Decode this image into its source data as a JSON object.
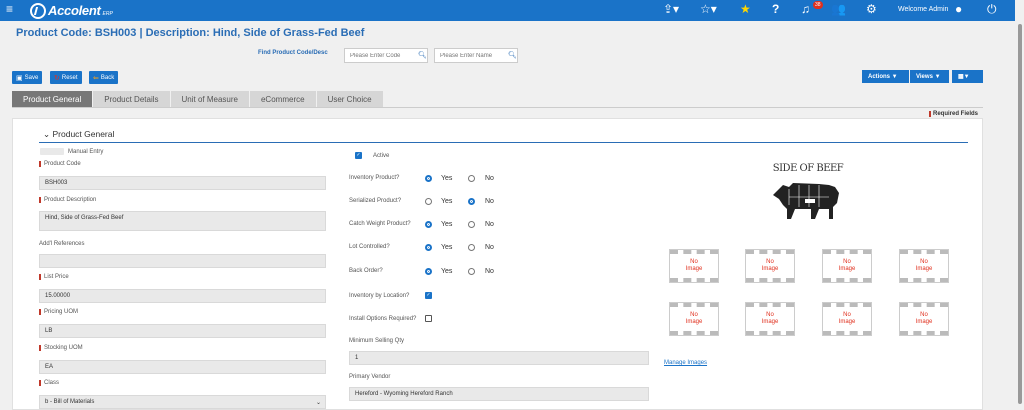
{
  "topbar": {
    "logo_text": "Accolent",
    "logo_suffix": "ERP",
    "notification_count": "38",
    "welcome": "Welcome Admin",
    "icons": [
      "menu-icon",
      "share-icon",
      "star-outline-icon",
      "star-icon",
      "help-icon",
      "bell-icon",
      "users-icon",
      "gear-icon",
      "user-icon",
      "power-icon"
    ]
  },
  "header": {
    "title": "Product Code:  BSH003 | Description: Hind, Side of Grass-Fed Beef",
    "find_label": "Find Product Code/Desc",
    "code_placeholder": "Please Enter Code",
    "name_placeholder": "Please Enter Name"
  },
  "toolbar": {
    "save": "Save",
    "reset": "Reset",
    "back": "Back",
    "actions": "Actions ▼",
    "views": "Views ▼",
    "grid": "▼"
  },
  "tabs": [
    {
      "label": "Product General",
      "active": true
    },
    {
      "label": "Product Details",
      "active": false
    },
    {
      "label": "Unit of Measure",
      "active": false
    },
    {
      "label": "eCommerce",
      "active": false
    },
    {
      "label": "User Choice",
      "active": false
    }
  ],
  "required_fields": "Required Fields",
  "section": {
    "title": "Product General"
  },
  "left": {
    "manual_entry": "Manual Entry",
    "product_code_label": "Product Code",
    "product_code": "BSH003",
    "product_desc_label": "Product Description",
    "product_desc": "Hind, Side of Grass-Fed Beef",
    "addl_ref_label": "Add'l References",
    "addl_ref": "",
    "list_price_label": "List Price",
    "list_price": "15.00000",
    "pricing_uom_label": "Pricing UOM",
    "pricing_uom": "LB",
    "stocking_uom_label": "Stocking UOM",
    "stocking_uom": "EA",
    "class_label": "Class",
    "class_value": "b - Bill of Materials"
  },
  "middle": {
    "active": "Active",
    "questions": [
      {
        "label": "Inventory Product?",
        "value": "Yes"
      },
      {
        "label": "Serialized Product?",
        "value": "No"
      },
      {
        "label": "Catch Weight Product?",
        "value": "Yes"
      },
      {
        "label": "Lot Controlled?",
        "value": "Yes"
      },
      {
        "label": "Back Order?",
        "value": "Yes"
      }
    ],
    "yes": "Yes",
    "no": "No",
    "inv_by_location": "Inventory by Location?",
    "install_options": "Install Options Required?",
    "min_selling_label": "Minimum Selling Qty",
    "min_selling": "1",
    "primary_vendor_label": "Primary Vendor",
    "primary_vendor": "Hereford - Wyoming Hereford Ranch"
  },
  "images": {
    "main_caption": "SIDE OF BEEF",
    "placeholder_line1": "No",
    "placeholder_line2": "Image",
    "manage": "Manage Images"
  }
}
